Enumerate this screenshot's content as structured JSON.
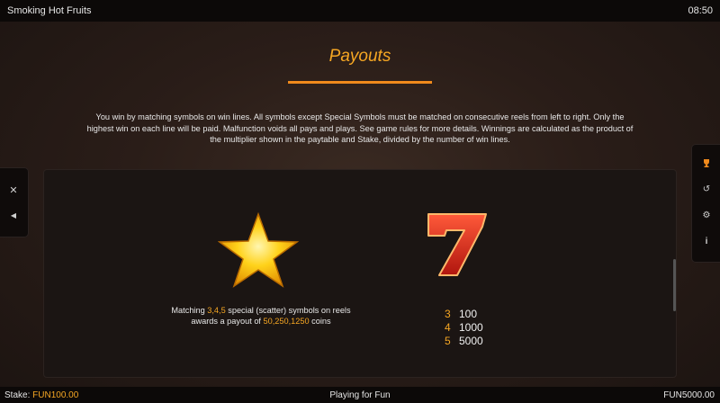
{
  "header": {
    "game_title": "Smoking Hot Fruits",
    "clock": "08:50"
  },
  "page": {
    "title": "Payouts",
    "intro": "You win by matching symbols on win lines. All symbols except Special Symbols must be matched on consecutive reels from left to right. Only the highest win on each line will be paid. Malfunction voids all pays and plays. See game rules for more details. Winnings are calculated as the product of the multiplier shown in the paytable and Stake, divided by the number of win lines."
  },
  "symbols": {
    "scatter": {
      "icon": "star-icon",
      "text_a": "Matching ",
      "counts": "3,4,5",
      "text_b": " special (scatter) symbols on reels awards a payout of ",
      "payouts": "50,250,1250",
      "text_c": " coins"
    },
    "seven": {
      "icon": "seven-icon",
      "rows": [
        {
          "count": "3",
          "amount": "100"
        },
        {
          "count": "4",
          "amount": "1000"
        },
        {
          "count": "5",
          "amount": "5000"
        }
      ]
    }
  },
  "left_menu": {
    "icons": [
      "close-icon",
      "back-arrow-icon"
    ],
    "close_glyph": "✕",
    "back_glyph": "◀"
  },
  "right_menu": {
    "icons": [
      "paytable-trophy-icon",
      "history-icon",
      "settings-gear-icon",
      "info-icon"
    ],
    "trophy_glyph": "🏆",
    "history_glyph": "↺",
    "settings_glyph": "⚙",
    "info_glyph": "i"
  },
  "footer": {
    "stake_label": "Stake:",
    "stake_value": "FUN100.00",
    "mode": "Playing for Fun",
    "balance": "FUN5000.00"
  },
  "colors": {
    "accent": "#f5a623",
    "title_underline": "#f08a1c",
    "background": "#2a1d18",
    "panel": "#1b1513",
    "seven_red": "#d8281c"
  }
}
